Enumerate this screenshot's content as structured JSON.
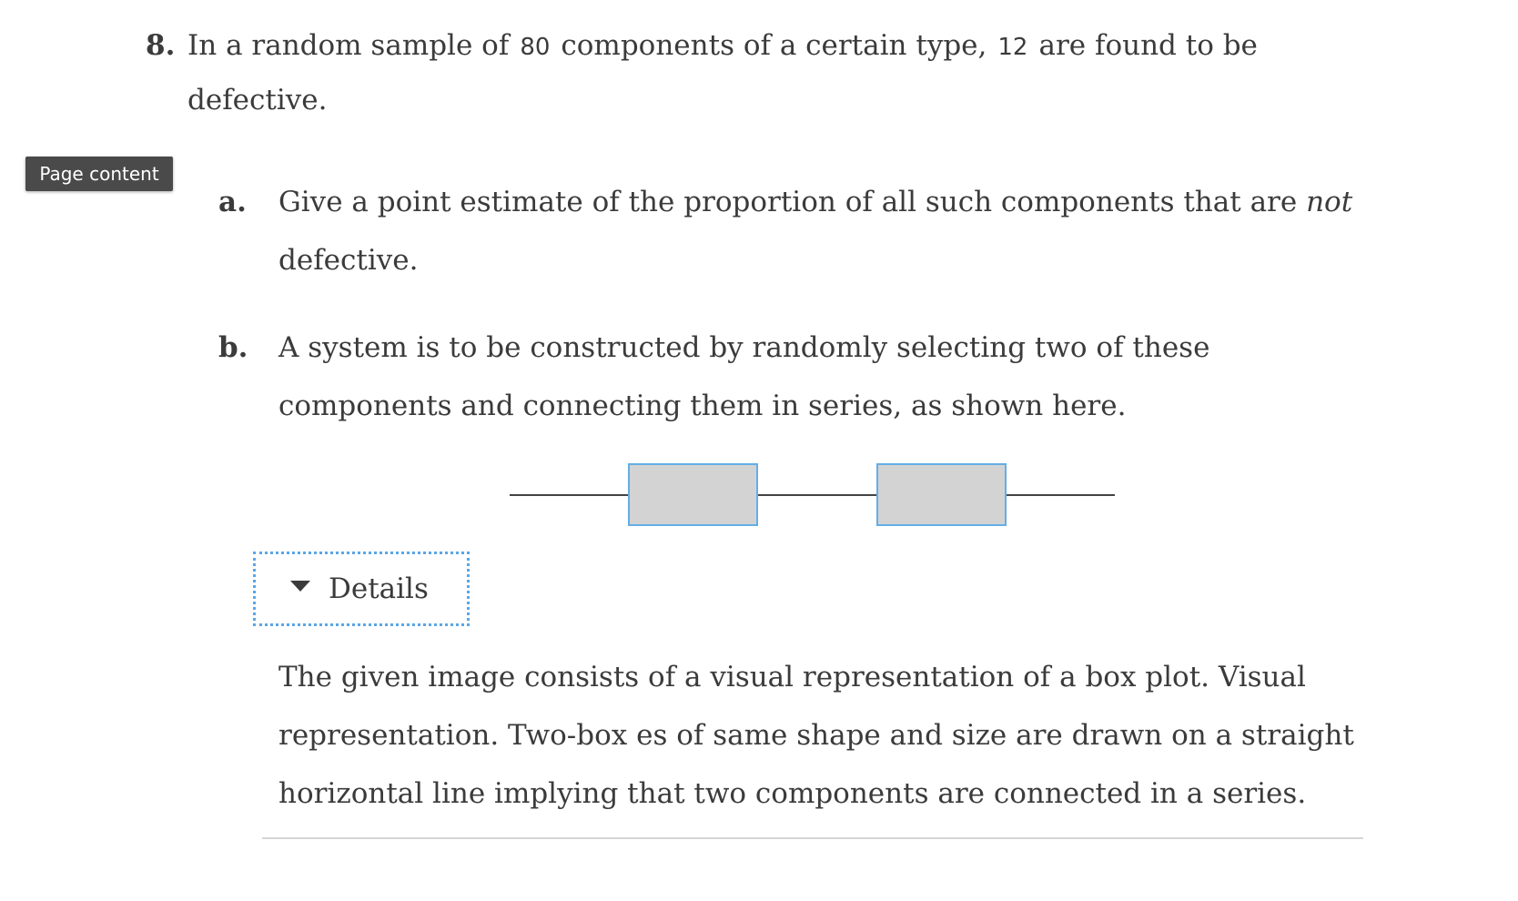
{
  "problem": {
    "number": "8.",
    "text_before": "In a random sample of",
    "sample_size": "80",
    "text_middle": "components of a certain type,",
    "defective_count": "12",
    "text_after": "are found to be",
    "text_continued": "defective."
  },
  "page_content_label": "Page content",
  "part_a": {
    "letter": "a.",
    "text_before": "Give a point estimate of the proportion of all such components that are",
    "emphasis": "not",
    "text_after": "defective."
  },
  "part_b": {
    "letter": "b.",
    "text": "A system is to be constructed by randomly selecting two of these components and connecting them in series, as shown here."
  },
  "diagram": {
    "box_fill": "#d3d3d3",
    "box_stroke": "#64aee6",
    "line_color": "#444444"
  },
  "details": {
    "label": "Details",
    "description": "The given image consists of a visual representation of a box plot. Visual representation. Two-box es of same shape and size are drawn on a straight horizontal line implying that two components are connected in a series."
  }
}
